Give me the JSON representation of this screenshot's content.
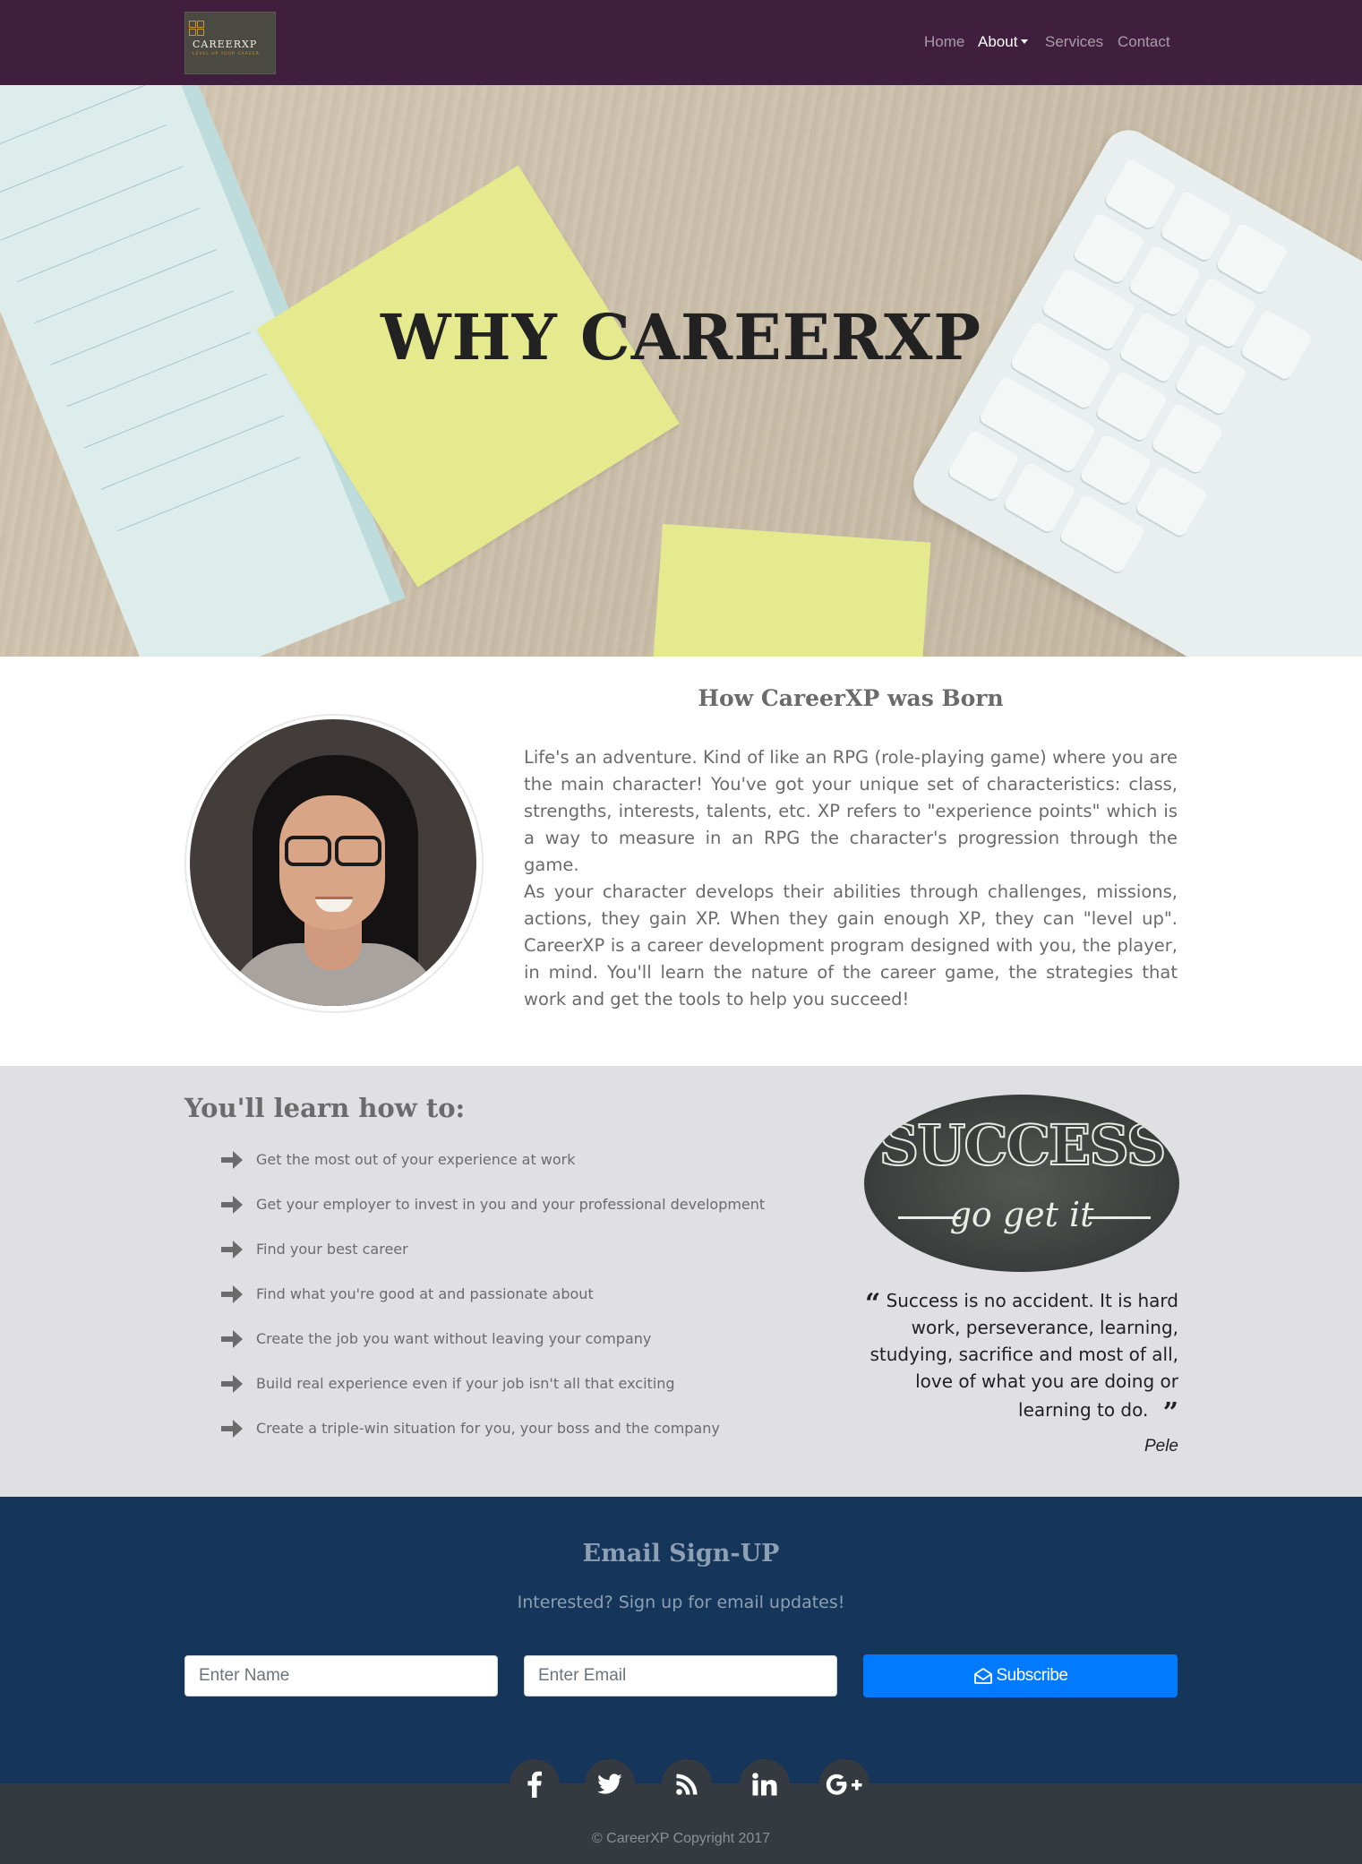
{
  "brand": {
    "name": "CAREERXP",
    "tagline": "LEVEL UP YOUR CAREER"
  },
  "nav": {
    "items": [
      {
        "label": "Home"
      },
      {
        "label": "About"
      },
      {
        "label": "Services"
      },
      {
        "label": "Contact"
      }
    ]
  },
  "hero": {
    "title": "WHY CAREERXP"
  },
  "about": {
    "heading": "How CareerXP was Born",
    "paragraph1": "Life's an adventure. Kind of like an RPG (role-playing game) where you are the main character! You've got your unique set of characteristics: class, strengths, interests, talents, etc. XP refers to \"experience points\" which is a way to measure in an RPG the character's progression through the game.",
    "paragraph2": "As your character develops their abilities through challenges, missions, actions, they gain XP. When they gain enough XP, they can \"level up\". CareerXP is a career development program designed with you, the player, in mind. You'll learn the nature of the career game, the strategies that work and get the tools to help you succeed!"
  },
  "learn": {
    "heading": "You'll learn how to:",
    "items": [
      "Get the most out of your experience at work",
      "Get your employer to invest in you and your professional development",
      "Find your best career",
      "Find what you're good at and passionate about",
      "Create the job you want without leaving your company",
      "Build real experience even if your job isn't all that exciting",
      "Create a triple-win situation for you, your boss and the company"
    ]
  },
  "success_image": {
    "big_text": "SUCCESS",
    "small_text": "go get it"
  },
  "quote": {
    "text": "Success is no accident. It is hard work, perseverance, learning, studying, sacrifice and most of all, love of what you are doing or learning to do.",
    "author": "Pele"
  },
  "signup": {
    "heading": "Email Sign-UP",
    "subheading": "Interested? Sign up for email updates!",
    "name_placeholder": "Enter Name",
    "email_placeholder": "Enter Email",
    "button_label": "Subscribe"
  },
  "social": [
    {
      "icon": "facebook-icon",
      "glyph": "f"
    },
    {
      "icon": "twitter-icon",
      "glyph": "t"
    },
    {
      "icon": "rss-icon",
      "glyph": "rss"
    },
    {
      "icon": "linkedin-icon",
      "glyph": "in"
    },
    {
      "icon": "google-plus-icon",
      "glyph": "G+"
    }
  ],
  "footer": {
    "copyright": "© CareerXP Copyright 2017"
  },
  "colors": {
    "navbar": "#401f3e",
    "learn_bg": "#e0e0e2",
    "signup_bg": "#15355a",
    "footer_bg": "#353a40",
    "button": "#007bff"
  }
}
